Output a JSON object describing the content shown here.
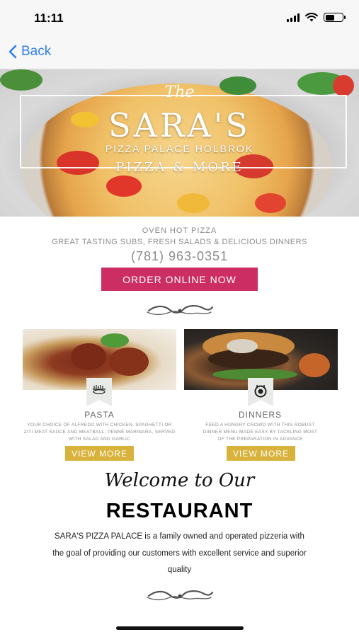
{
  "status_bar": {
    "time": "11:11",
    "icons": [
      "cellular-signal-icon",
      "wifi-icon",
      "battery-icon"
    ]
  },
  "nav": {
    "back_label": "Back",
    "accent_color": "#2f7df6"
  },
  "hero": {
    "the": "The",
    "brand": "SARA'S",
    "subtitle": "PIZZA PALACE HOLBROK",
    "tagline": "PIZZA & MORE"
  },
  "info": {
    "line1": "OVEN HOT PIZZA",
    "line2": "GREAT TASTING SUBS, FRESH SALADS & DELICIOUS DINNERS",
    "phone": "(781) 963-0351"
  },
  "order_button": {
    "label": "ORDER ONLINE NOW",
    "color": "#cc2e63"
  },
  "cards": [
    {
      "title": "PASTA",
      "icon": "pasta-icon",
      "description": "YOUR CHOICE OF ALFREDO WITH CHICKEN, SPAGHETTI OR ZITI MEAT SAUCE AND MEATBALL, PENNE MARINARA, SERVED WITH SALAD AND GARLIC",
      "button": "VIEW MORE"
    },
    {
      "title": "DINNERS",
      "icon": "dinner-plate-icon",
      "description": "FEED A HUNGRY CROWD WITH THIS ROBUST DINNER MENU MADE EASY BY TACKLING MOST OF THE PREPARATION IN ADVANCE",
      "button": "VIEW MORE"
    }
  ],
  "view_button_color": "#d8b23b",
  "welcome": {
    "script_heading": "Welcome to Our",
    "heading": "RESTAURANT",
    "body": "SARA'S PIZZA PALACE is a family owned and operated pizzeria with the goal of providing our customers with excellent service and superior quality"
  }
}
